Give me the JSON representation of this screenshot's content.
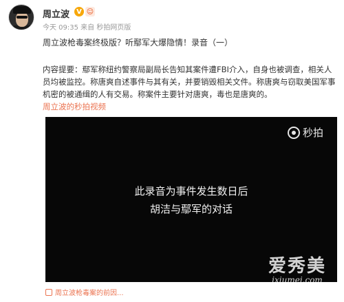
{
  "post": {
    "username": "周立波",
    "v_badge": "V",
    "level_badge": "☺",
    "meta": "今天 09:35 来自 秒拍网页版",
    "title": "周立波枪毒案终极版？听鄢军大爆隐情！录音（一）",
    "body_prefix": "内容提要：",
    "body_text": "鄢军称纽约警察局副局长告知其案件遭FBI介入，自身也被调查，相关人员均被监控。称唐爽自述事件与其有关，并要销毁相关文件。称唐爽与窃取美国军事机密的被通缉的人有交易。称案件主要针对唐爽，毒也是唐爽的。",
    "body_link": "周立波的秒拍视频"
  },
  "video": {
    "brand": "秒拍",
    "subtitle_line1": "此录音为事件发生数日后",
    "subtitle_line2": "胡洁与鄢军的对话"
  },
  "watermark": {
    "cn": "爱秀美",
    "url": "ixiumei.com"
  },
  "footer": {
    "link_text": "周立波枪毒案的前因..."
  },
  "colors": {
    "link": "#eb7350",
    "video_bg": "#070707",
    "v_badge": "#f7a70a"
  }
}
